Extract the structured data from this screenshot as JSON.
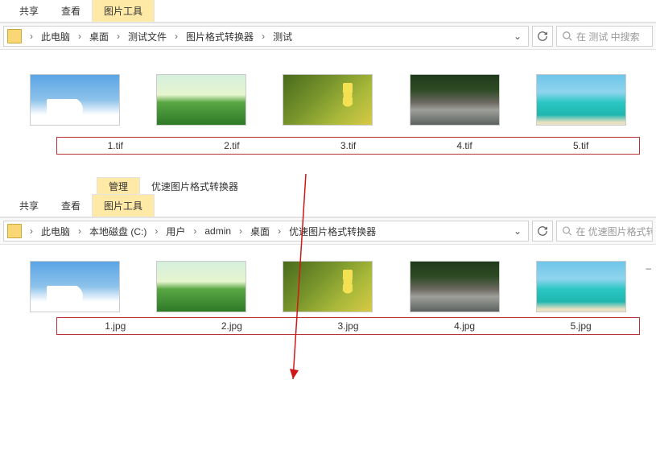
{
  "window1": {
    "menubar": {
      "share": "共享",
      "view": "查看",
      "tools": "图片工具"
    },
    "breadcrumb": [
      "此电脑",
      "桌面",
      "测试文件",
      "图片格式转换器",
      "测试"
    ],
    "search_placeholder": "在 测试 中搜索",
    "files": [
      {
        "name": "1.tif",
        "thumb": "clouds"
      },
      {
        "name": "2.tif",
        "thumb": "field"
      },
      {
        "name": "3.tif",
        "thumb": "flower"
      },
      {
        "name": "4.tif",
        "thumb": "river"
      },
      {
        "name": "5.tif",
        "thumb": "beach"
      }
    ]
  },
  "window2": {
    "tools_header": {
      "category": "管理",
      "title": "优速图片格式转换器"
    },
    "menubar": {
      "share": "共享",
      "view": "查看",
      "tools": "图片工具"
    },
    "breadcrumb": [
      "此电脑",
      "本地磁盘 (C:)",
      "用户",
      "admin",
      "桌面",
      "优速图片格式转换器"
    ],
    "search_placeholder": "在 优速图片格式转",
    "files": [
      {
        "name": "1.jpg",
        "thumb": "clouds"
      },
      {
        "name": "2.jpg",
        "thumb": "field"
      },
      {
        "name": "3.jpg",
        "thumb": "flower"
      },
      {
        "name": "4.jpg",
        "thumb": "river"
      },
      {
        "name": "5.jpg",
        "thumb": "beach"
      }
    ]
  }
}
